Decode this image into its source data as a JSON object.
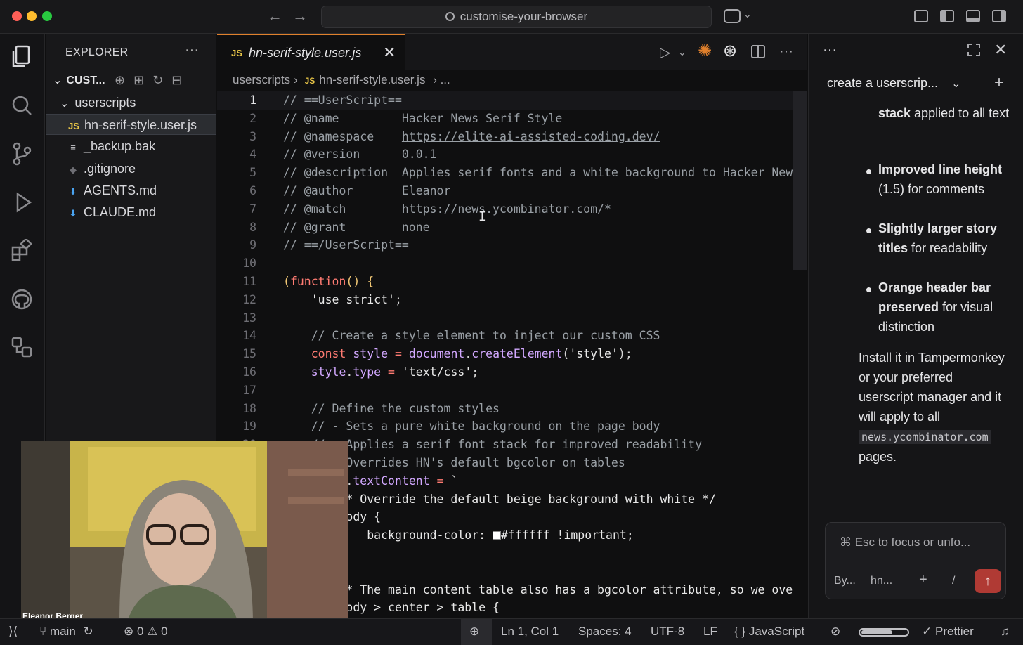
{
  "titlebar": {
    "search_text": "customise-your-browser",
    "back_glyph": "←",
    "forward_glyph": "→",
    "colors": {
      "close": "#ff5f57",
      "minimize": "#febc2e",
      "zoom": "#28c840"
    }
  },
  "explorer": {
    "title": "EXPLORER",
    "more": "···",
    "root": "CUST...",
    "root_glyph": "⌄",
    "folder_glyph": "⌄",
    "folder": "userscripts",
    "files": [
      {
        "badge": "JS",
        "name": "hn-serif-style.user.js",
        "selected": true,
        "badge_color": "#e8c547"
      },
      {
        "badge": "≡",
        "name": "_backup.bak",
        "selected": false,
        "badge_color": "#c8c8cc"
      },
      {
        "badge": "◆",
        "name": ".gitignore",
        "selected": false,
        "badge_color": "#6e6e74"
      },
      {
        "badge": "⬇",
        "name": "AGENTS.md",
        "selected": false,
        "badge_color": "#4aa3f0"
      },
      {
        "badge": "⬇",
        "name": "CLAUDE.md",
        "selected": false,
        "badge_color": "#4aa3f0"
      }
    ]
  },
  "editor": {
    "tab_badge": "JS",
    "tab_name": "hn-serif-style.user.js",
    "tab_close": "✕",
    "breadcrumb": {
      "folder": "userscripts",
      "sep": "›",
      "badge": "JS",
      "file": "hn-serif-style.user.js",
      "tail": "› ..."
    }
  },
  "code_lines": [
    {
      "n": "1",
      "html": "<span class=\"c\">// ==UserScript==</span>"
    },
    {
      "n": "2",
      "html": "<span class=\"c\">// @name         Hacker News Serif Style</span>"
    },
    {
      "n": "3",
      "html": "<span class=\"c\">// @namespace    </span><span class=\"u\">https://elite-ai-assisted-coding.dev/</span>"
    },
    {
      "n": "4",
      "html": "<span class=\"c\">// @version      0.0.1</span>"
    },
    {
      "n": "5",
      "html": "<span class=\"c\">// @description  Applies serif fonts and a white background to Hacker New</span>"
    },
    {
      "n": "6",
      "html": "<span class=\"c\">// @author       Eleanor</span>"
    },
    {
      "n": "7",
      "html": "<span class=\"c\">// @match        </span><span class=\"u\">https://news.ycombinator.com/*</span>"
    },
    {
      "n": "8",
      "html": "<span class=\"c\">// @grant        none</span>"
    },
    {
      "n": "9",
      "html": "<span class=\"c\">// ==/UserScript==</span>"
    },
    {
      "n": "10",
      "html": ""
    },
    {
      "n": "11",
      "html": "<span class=\"p\">(</span><span class=\"k\">function</span><span class=\"p\">() {</span>"
    },
    {
      "n": "12",
      "html": "    <span class=\"s\">'use strict'</span>;"
    },
    {
      "n": "13",
      "html": ""
    },
    {
      "n": "14",
      "html": "    <span class=\"c\">// Create a style element to inject our custom CSS</span>"
    },
    {
      "n": "15",
      "html": "    <span class=\"k\">const</span> <span class=\"f\">style</span> <span class=\"k\">=</span> <span class=\"f\">document</span>.<span class=\"f\">createElement</span>(<span class=\"s\">'style'</span>);"
    },
    {
      "n": "16",
      "html": "    <span class=\"f\">style</span>.<span class=\"f\" style=\"text-decoration:line-through\">type</span> <span class=\"k\">=</span> <span class=\"s\">'text/css'</span>;"
    },
    {
      "n": "17",
      "html": ""
    },
    {
      "n": "18",
      "html": "    <span class=\"c\">// Define the custom styles</span>"
    },
    {
      "n": "19",
      "html": "    <span class=\"c\">// - Sets a pure white background on the page body</span>"
    },
    {
      "n": "20",
      "html": "    <span class=\"c\">// - Applies a serif font stack for improved readability</span>"
    },
    {
      "n": "21",
      "html": "    <span class=\"c\">// - Overrides HN's default bgcolor on tables</span>"
    },
    {
      "n": "22",
      "html": "    <span class=\"f\">style</span>.<span class=\"f\">textContent</span> <span class=\"k\">=</span> <span class=\"s\">`</span>"
    },
    {
      "n": "23",
      "html": "        <span class=\"s\">/* Override the default beige background with white */</span>"
    },
    {
      "n": "24",
      "html": "        <span class=\"s\">body {</span>"
    },
    {
      "n": "25",
      "html": "            <span class=\"s\">background-color: <span style=\"display:inline-block;width:12px;height:12px;background:#ffffff;border:1px solid #888;vertical-align:-1px\"></span>#ffffff !important;</span>"
    },
    {
      "n": "26",
      "html": ""
    },
    {
      "n": "27",
      "html": ""
    },
    {
      "n": "28",
      "html": "        <span class=\"s\">/* The main content table also has a bgcolor attribute, so we ove</span>"
    },
    {
      "n": "29",
      "html": "        <span class=\"s\">body &gt; center &gt; table {</span>"
    }
  ],
  "chat": {
    "title": "create a userscrip...",
    "title_chevron": "⌄",
    "more": "···",
    "close": "✕",
    "plus": "+",
    "bullets": [
      {
        "html": "<b>New Roman serif font stack</b> applied to all text"
      },
      {
        "html": "<b>Improved line height</b> (1.5) for comments"
      },
      {
        "html": "<b>Slightly larger story titles</b> for readability"
      },
      {
        "html": "<b>Orange header bar preserved</b> for visual distinction"
      }
    ],
    "paragraph_html": "Install it in Tampermonkey or your preferred userscript manager and it will apply to all <code>news.ycombinator.com</code> pages.",
    "input_placeholder": "⌘ Esc to focus or unfo...",
    "chip_agent": "By...",
    "chip_file": "hn...",
    "chip_plus": "+",
    "chip_slash": "/",
    "send_glyph": "↑"
  },
  "webcam": {
    "name": "Eleanor Berger"
  },
  "status": {
    "branch": "main",
    "errors": "0",
    "warnings": "0",
    "position": "Ln 1, Col 1",
    "spaces": "Spaces: 4",
    "encoding": "UTF-8",
    "eol": "LF",
    "language": "JavaScript",
    "formatter": "Prettier"
  }
}
